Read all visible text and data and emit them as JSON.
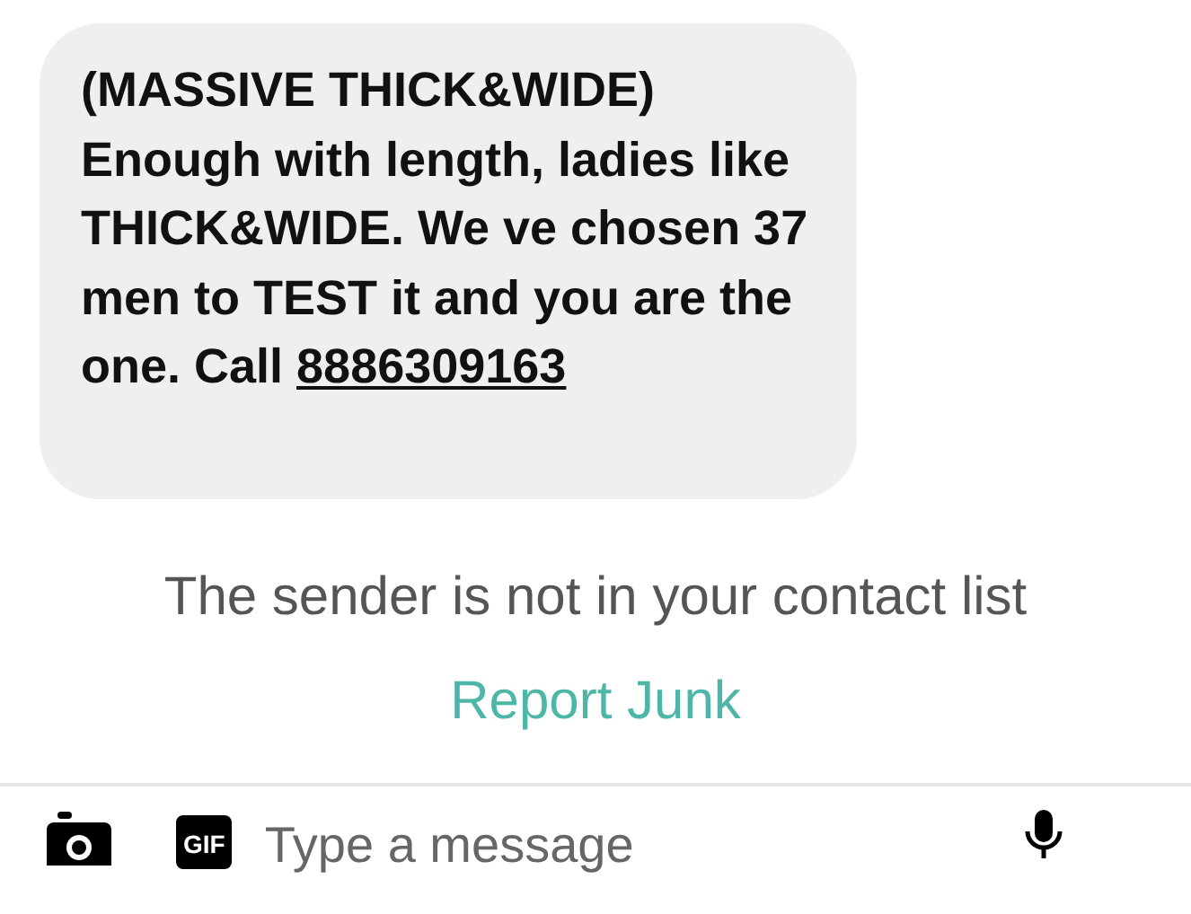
{
  "messages": [
    {
      "text": "(MASSIVE THICK&WIDE) Enough with length, ladies like THICK&WIDE. We ve chosen 37 men to TEST it and you are the one. Call",
      "link": "8886309163"
    }
  ],
  "notice": "The sender is not in your contact list",
  "report_link": "Report Junk",
  "composer": {
    "gif_label": "GIF",
    "placeholder": "Type a message"
  }
}
